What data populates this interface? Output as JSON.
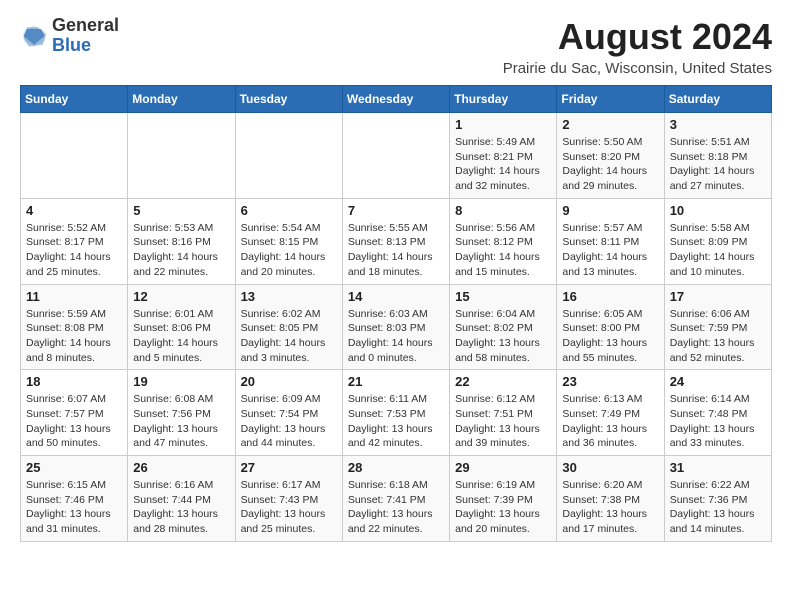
{
  "header": {
    "logo_general": "General",
    "logo_blue": "Blue",
    "month_year": "August 2024",
    "location": "Prairie du Sac, Wisconsin, United States"
  },
  "days_of_week": [
    "Sunday",
    "Monday",
    "Tuesday",
    "Wednesday",
    "Thursday",
    "Friday",
    "Saturday"
  ],
  "weeks": [
    [
      {
        "day": "",
        "info": ""
      },
      {
        "day": "",
        "info": ""
      },
      {
        "day": "",
        "info": ""
      },
      {
        "day": "",
        "info": ""
      },
      {
        "day": "1",
        "info": "Sunrise: 5:49 AM\nSunset: 8:21 PM\nDaylight: 14 hours\nand 32 minutes."
      },
      {
        "day": "2",
        "info": "Sunrise: 5:50 AM\nSunset: 8:20 PM\nDaylight: 14 hours\nand 29 minutes."
      },
      {
        "day": "3",
        "info": "Sunrise: 5:51 AM\nSunset: 8:18 PM\nDaylight: 14 hours\nand 27 minutes."
      }
    ],
    [
      {
        "day": "4",
        "info": "Sunrise: 5:52 AM\nSunset: 8:17 PM\nDaylight: 14 hours\nand 25 minutes."
      },
      {
        "day": "5",
        "info": "Sunrise: 5:53 AM\nSunset: 8:16 PM\nDaylight: 14 hours\nand 22 minutes."
      },
      {
        "day": "6",
        "info": "Sunrise: 5:54 AM\nSunset: 8:15 PM\nDaylight: 14 hours\nand 20 minutes."
      },
      {
        "day": "7",
        "info": "Sunrise: 5:55 AM\nSunset: 8:13 PM\nDaylight: 14 hours\nand 18 minutes."
      },
      {
        "day": "8",
        "info": "Sunrise: 5:56 AM\nSunset: 8:12 PM\nDaylight: 14 hours\nand 15 minutes."
      },
      {
        "day": "9",
        "info": "Sunrise: 5:57 AM\nSunset: 8:11 PM\nDaylight: 14 hours\nand 13 minutes."
      },
      {
        "day": "10",
        "info": "Sunrise: 5:58 AM\nSunset: 8:09 PM\nDaylight: 14 hours\nand 10 minutes."
      }
    ],
    [
      {
        "day": "11",
        "info": "Sunrise: 5:59 AM\nSunset: 8:08 PM\nDaylight: 14 hours\nand 8 minutes."
      },
      {
        "day": "12",
        "info": "Sunrise: 6:01 AM\nSunset: 8:06 PM\nDaylight: 14 hours\nand 5 minutes."
      },
      {
        "day": "13",
        "info": "Sunrise: 6:02 AM\nSunset: 8:05 PM\nDaylight: 14 hours\nand 3 minutes."
      },
      {
        "day": "14",
        "info": "Sunrise: 6:03 AM\nSunset: 8:03 PM\nDaylight: 14 hours\nand 0 minutes."
      },
      {
        "day": "15",
        "info": "Sunrise: 6:04 AM\nSunset: 8:02 PM\nDaylight: 13 hours\nand 58 minutes."
      },
      {
        "day": "16",
        "info": "Sunrise: 6:05 AM\nSunset: 8:00 PM\nDaylight: 13 hours\nand 55 minutes."
      },
      {
        "day": "17",
        "info": "Sunrise: 6:06 AM\nSunset: 7:59 PM\nDaylight: 13 hours\nand 52 minutes."
      }
    ],
    [
      {
        "day": "18",
        "info": "Sunrise: 6:07 AM\nSunset: 7:57 PM\nDaylight: 13 hours\nand 50 minutes."
      },
      {
        "day": "19",
        "info": "Sunrise: 6:08 AM\nSunset: 7:56 PM\nDaylight: 13 hours\nand 47 minutes."
      },
      {
        "day": "20",
        "info": "Sunrise: 6:09 AM\nSunset: 7:54 PM\nDaylight: 13 hours\nand 44 minutes."
      },
      {
        "day": "21",
        "info": "Sunrise: 6:11 AM\nSunset: 7:53 PM\nDaylight: 13 hours\nand 42 minutes."
      },
      {
        "day": "22",
        "info": "Sunrise: 6:12 AM\nSunset: 7:51 PM\nDaylight: 13 hours\nand 39 minutes."
      },
      {
        "day": "23",
        "info": "Sunrise: 6:13 AM\nSunset: 7:49 PM\nDaylight: 13 hours\nand 36 minutes."
      },
      {
        "day": "24",
        "info": "Sunrise: 6:14 AM\nSunset: 7:48 PM\nDaylight: 13 hours\nand 33 minutes."
      }
    ],
    [
      {
        "day": "25",
        "info": "Sunrise: 6:15 AM\nSunset: 7:46 PM\nDaylight: 13 hours\nand 31 minutes."
      },
      {
        "day": "26",
        "info": "Sunrise: 6:16 AM\nSunset: 7:44 PM\nDaylight: 13 hours\nand 28 minutes."
      },
      {
        "day": "27",
        "info": "Sunrise: 6:17 AM\nSunset: 7:43 PM\nDaylight: 13 hours\nand 25 minutes."
      },
      {
        "day": "28",
        "info": "Sunrise: 6:18 AM\nSunset: 7:41 PM\nDaylight: 13 hours\nand 22 minutes."
      },
      {
        "day": "29",
        "info": "Sunrise: 6:19 AM\nSunset: 7:39 PM\nDaylight: 13 hours\nand 20 minutes."
      },
      {
        "day": "30",
        "info": "Sunrise: 6:20 AM\nSunset: 7:38 PM\nDaylight: 13 hours\nand 17 minutes."
      },
      {
        "day": "31",
        "info": "Sunrise: 6:22 AM\nSunset: 7:36 PM\nDaylight: 13 hours\nand 14 minutes."
      }
    ]
  ]
}
